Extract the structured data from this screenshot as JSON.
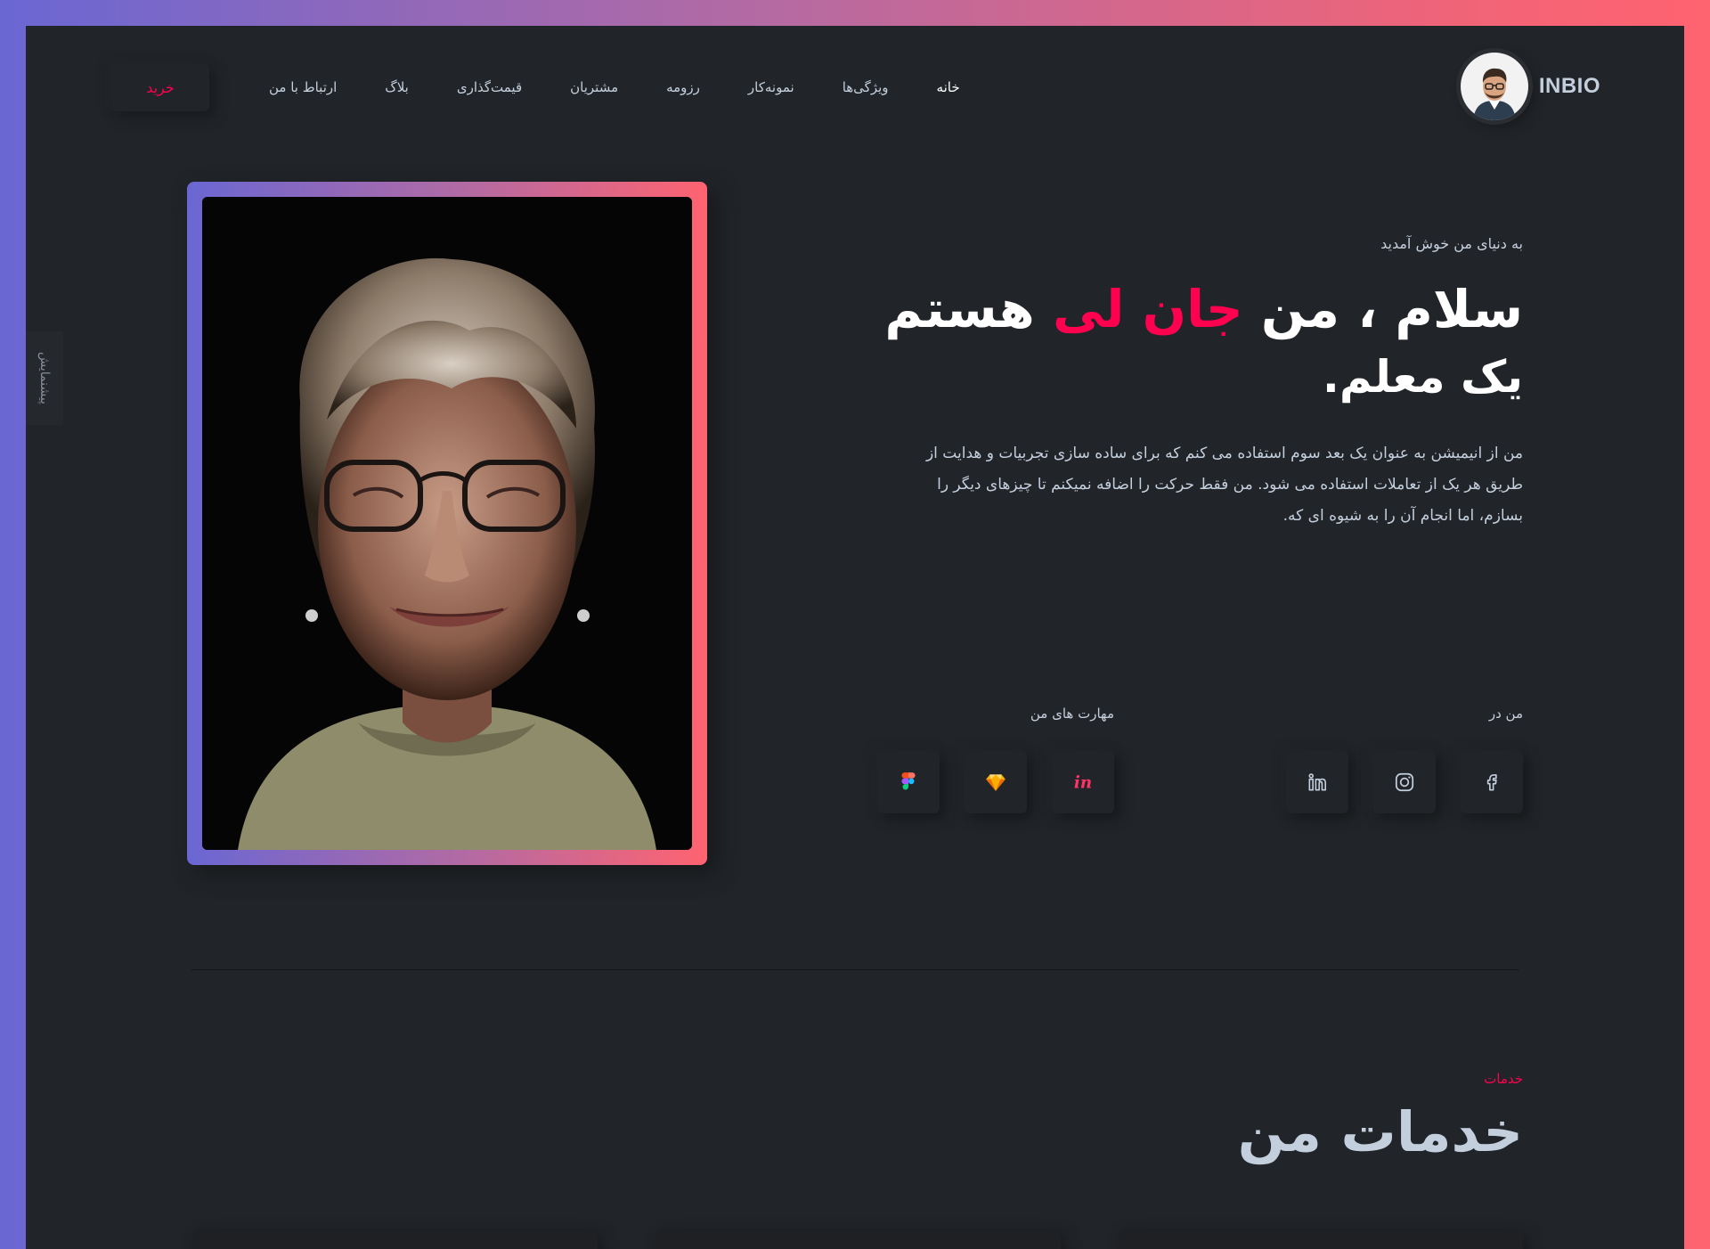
{
  "header": {
    "brand": "INBIO",
    "buy_button": "خرید",
    "nav": [
      {
        "label": "خانه",
        "active": true
      },
      {
        "label": "ویژگی‌ها"
      },
      {
        "label": "نمونه‌کار"
      },
      {
        "label": "رزومه"
      },
      {
        "label": "مشتریان"
      },
      {
        "label": "قیمت‌گذاری"
      },
      {
        "label": "بلاگ"
      },
      {
        "label": "ارتباط با من"
      }
    ]
  },
  "side_tab": "پیشنمایش",
  "hero": {
    "welcome": "به دنیای من خوش آمدید",
    "greeting_prefix": "سلام ، من",
    "name": "جان لی",
    "greeting_suffix": "هستم",
    "role": "یک معلم.",
    "description": "من از انیمیشن به عنوان یک بعد سوم استفاده می کنم که برای ساده سازی تجربیات و هدایت از طریق هر یک از تعاملات استفاده می شود. من فقط حرکت را اضافه نمیکنم تا چیزهای دیگر را بسازم، اما انجام آن را به شیوه ای که."
  },
  "socials": {
    "title": "من در",
    "items": [
      {
        "icon": "facebook-icon"
      },
      {
        "icon": "instagram-icon"
      },
      {
        "icon": "linkedin-icon"
      }
    ]
  },
  "skills": {
    "title": "مهارت های من",
    "items": [
      {
        "icon": "invision-icon"
      },
      {
        "icon": "sketch-icon"
      },
      {
        "icon": "figma-icon"
      }
    ]
  },
  "services": {
    "kicker": "خدمات",
    "title": "خدمات من"
  },
  "colors": {
    "accent": "#ff014f",
    "background": "#212428",
    "text": "#c4cfde"
  }
}
